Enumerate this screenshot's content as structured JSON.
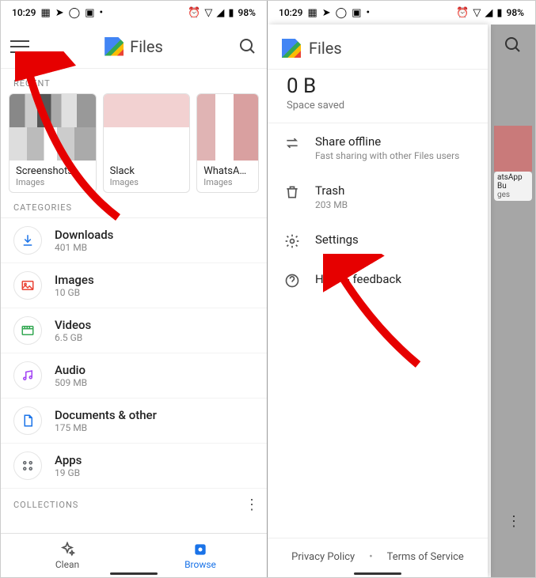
{
  "status": {
    "time": "10:29",
    "battery": "98%"
  },
  "app": {
    "title": "Files"
  },
  "recent_label": "RECENT",
  "recents": [
    {
      "title": "Screenshots",
      "sub": "Images"
    },
    {
      "title": "Slack",
      "sub": "Images"
    },
    {
      "title": "WhatsApp Bu",
      "sub": "Images"
    }
  ],
  "categories_label": "CATEGORIES",
  "categories": [
    {
      "title": "Downloads",
      "sub": "401 MB",
      "color": "#1a73e8"
    },
    {
      "title": "Images",
      "sub": "10 GB",
      "color": "#ea4335"
    },
    {
      "title": "Videos",
      "sub": "6.5 GB",
      "color": "#34a853"
    },
    {
      "title": "Audio",
      "sub": "509 MB",
      "color": "#a142f4"
    },
    {
      "title": "Documents & other",
      "sub": "175 MB",
      "color": "#1a73e8"
    },
    {
      "title": "Apps",
      "sub": "19 GB",
      "color": "#5f6368"
    }
  ],
  "collections_label": "COLLECTIONS",
  "nav": {
    "clean": "Clean",
    "browse": "Browse"
  },
  "drawer": {
    "title": "Files",
    "space_value": "0 B",
    "space_label": "Space saved",
    "items": [
      {
        "title": "Share offline",
        "sub": "Fast sharing with other Files users"
      },
      {
        "title": "Trash",
        "sub": "203 MB"
      },
      {
        "title": "Settings",
        "sub": ""
      },
      {
        "title": "Help & feedback",
        "sub": ""
      }
    ],
    "footer": {
      "privacy": "Privacy Policy",
      "terms": "Terms of Service"
    }
  },
  "dim_strip": {
    "card_title": "atsApp Bu",
    "card_sub": "ges"
  }
}
